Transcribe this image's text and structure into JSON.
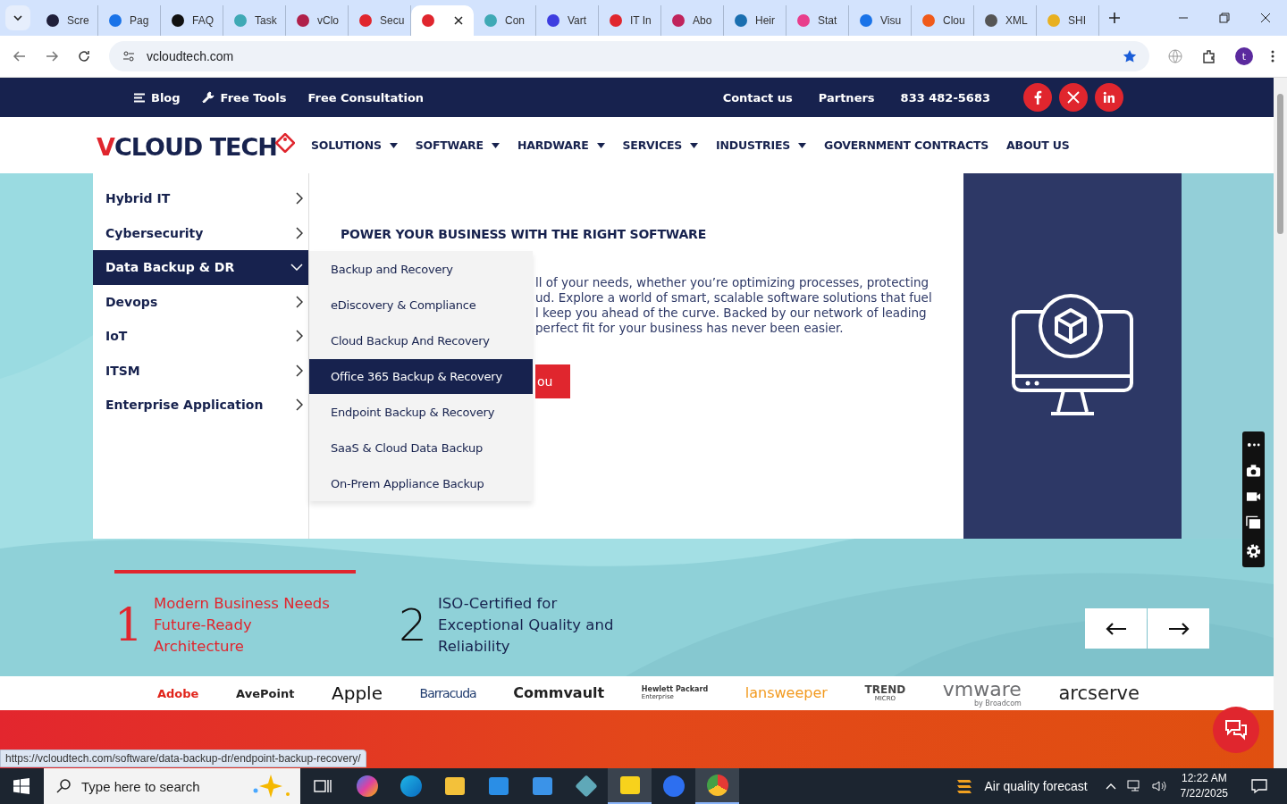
{
  "browser": {
    "tabs": [
      {
        "label": "Scre",
        "selected": false,
        "color": "#1f1f3a"
      },
      {
        "label": "Pag",
        "selected": false,
        "color": "#1a73e8"
      },
      {
        "label": "FAQ",
        "selected": false,
        "color": "#111111"
      },
      {
        "label": "Task",
        "selected": false,
        "color": "#3fa9b5"
      },
      {
        "label": "vClo",
        "selected": false,
        "color": "#b0204a"
      },
      {
        "label": "Secu",
        "selected": false,
        "color": "#e0262e"
      },
      {
        "selected": true,
        "color": "#e0262e"
      },
      {
        "label": "Con",
        "selected": false,
        "color": "#3fa9b5"
      },
      {
        "label": "Vart",
        "selected": false,
        "color": "#3d3de0"
      },
      {
        "label": "IT In",
        "selected": false,
        "color": "#e0262e"
      },
      {
        "label": "Abo",
        "selected": false,
        "color": "#c0245c"
      },
      {
        "label": "Heir",
        "selected": false,
        "color": "#1a6fb0"
      },
      {
        "label": "Stat",
        "selected": false,
        "color": "#e83e8c"
      },
      {
        "label": "Visu",
        "selected": false,
        "color": "#1a73e8"
      },
      {
        "label": "Clou",
        "selected": false,
        "color": "#f05a1a"
      },
      {
        "label": "XML",
        "selected": false,
        "color": "#555555"
      },
      {
        "label": "SHI",
        "selected": false,
        "color": "#e8b020"
      }
    ],
    "address": "vcloudtech.com",
    "profile": "t"
  },
  "topbar": {
    "left": [
      {
        "label": "Blog"
      },
      {
        "label": "Free Tools"
      },
      {
        "label": "Free Consultation"
      }
    ],
    "right": [
      "Contact us",
      "Partners",
      "833 482-5683"
    ]
  },
  "header": {
    "logo": {
      "first": "V",
      "rest": "CLOUD TECH"
    },
    "nav": [
      {
        "label": "SOLUTIONS",
        "caret": true
      },
      {
        "label": "SOFTWARE",
        "caret": true
      },
      {
        "label": "HARDWARE",
        "caret": true
      },
      {
        "label": "SERVICES",
        "caret": true
      },
      {
        "label": "INDUSTRIES",
        "caret": true
      },
      {
        "label": "GOVERNMENT CONTRACTS",
        "caret": false
      },
      {
        "label": "ABOUT US",
        "caret": false
      }
    ]
  },
  "mega_menu": {
    "categories": [
      {
        "label": "Hybrid IT",
        "selected": false
      },
      {
        "label": "Cybersecurity",
        "selected": false
      },
      {
        "label": "Data Backup & DR",
        "selected": true
      },
      {
        "label": "Devops",
        "selected": false
      },
      {
        "label": "IoT",
        "selected": false
      },
      {
        "label": "ITSM",
        "selected": false
      },
      {
        "label": "Enterprise Application",
        "selected": false
      }
    ],
    "submenu": [
      {
        "label": "Backup and Recovery",
        "selected": false
      },
      {
        "label": "eDiscovery & Compliance",
        "selected": false
      },
      {
        "label": "Cloud Backup And Recovery",
        "selected": false
      },
      {
        "label": "Office 365 Backup & Recovery",
        "selected": true
      },
      {
        "label": "Endpoint Backup & Recovery",
        "selected": false
      },
      {
        "label": "SaaS & Cloud Data Backup",
        "selected": false
      },
      {
        "label": "On-Prem Appliance Backup",
        "selected": false
      }
    ],
    "heading": "POWER YOUR BUSINESS WITH THE RIGHT SOFTWARE",
    "paragraph_lines": [
      "ll of your needs, whether you’re optimizing processes, protecting",
      "ud. Explore a world of smart, scalable software solutions that fuel",
      "l keep you ahead of the curve. Backed by our network of leading",
      "perfect fit for your business has never been easier."
    ],
    "button": "ou"
  },
  "features": [
    {
      "number": "1",
      "text": "Modern Business Needs Future-Ready Architecture",
      "active": true
    },
    {
      "number": "2",
      "text": "ISO-Certified for Exceptional Quality and Reliability",
      "active": false
    }
  ],
  "partners": [
    {
      "text": "Adobe",
      "color": "#e1251b"
    },
    {
      "text": "AvePoint",
      "color": "#222222"
    },
    {
      "text": "Apple",
      "color": "#111111"
    },
    {
      "text": "Barracuda",
      "color": "#1f3b6e"
    },
    {
      "text": "Commvault",
      "color": "#222222"
    },
    {
      "text": "Hewlett Packard",
      "sub": "Enterprise",
      "color": "#333333"
    },
    {
      "text": "lansweeper",
      "color": "#f29a1f"
    },
    {
      "text": "TREND",
      "sub": "MICRO",
      "color": "#444444"
    },
    {
      "text": "vmware",
      "sub": "by Broadcom",
      "color": "#6d6e71"
    },
    {
      "text": "arcserve",
      "color": "#222222"
    }
  ],
  "status_url": "https://vcloudtech.com/software/data-backup-dr/endpoint-backup-recovery/",
  "taskbar": {
    "search_placeholder": "Type here to search",
    "weather": "Air quality forecast",
    "time": "12:22 AM",
    "date": "7/22/2025"
  }
}
